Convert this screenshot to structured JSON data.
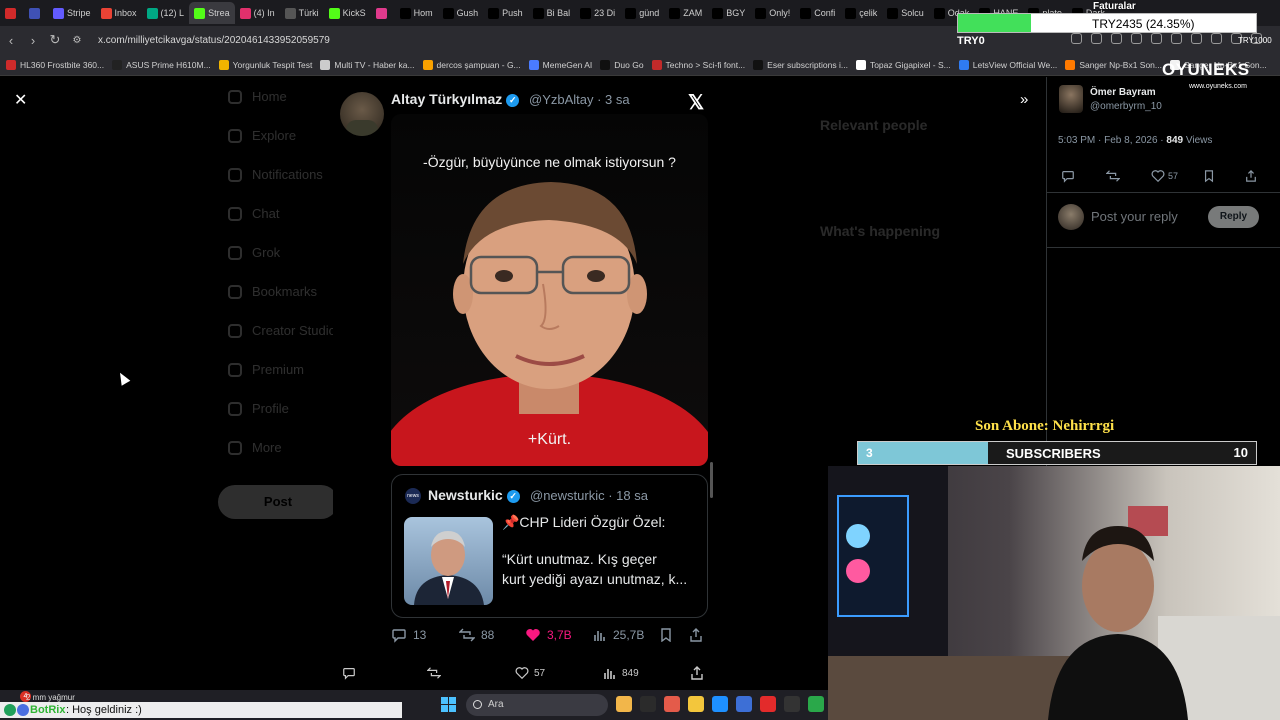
{
  "browser": {
    "tabs": [
      {
        "label": "",
        "color": "#d12a2a"
      },
      {
        "label": "",
        "color": "#3f51b5"
      },
      {
        "label": "Stripe",
        "color": "#635bff"
      },
      {
        "label": "Inbox",
        "color": "#ea4335"
      },
      {
        "label": "(12) L",
        "color": "#00a884"
      },
      {
        "label": "Strea",
        "color": "#53fc18",
        "active": true
      },
      {
        "label": "(4) In",
        "color": "#e1306c"
      },
      {
        "label": "Türki",
        "color": "#555555"
      },
      {
        "label": "KickS",
        "color": "#53fc18"
      },
      {
        "label": "",
        "color": "#e03a8c"
      },
      {
        "label": "Hom",
        "color": "#000000"
      },
      {
        "label": "Gush",
        "color": "#000000"
      },
      {
        "label": "Push",
        "color": "#000000"
      },
      {
        "label": "Bi Bal",
        "color": "#000000"
      },
      {
        "label": "23 Di",
        "color": "#000000"
      },
      {
        "label": "günd",
        "color": "#000000"
      },
      {
        "label": "ZAM",
        "color": "#000000"
      },
      {
        "label": "BGY",
        "color": "#000000"
      },
      {
        "label": "Only!",
        "color": "#000000"
      },
      {
        "label": "Confi",
        "color": "#000000"
      },
      {
        "label": "çelik",
        "color": "#000000"
      },
      {
        "label": "Solcu",
        "color": "#000000"
      },
      {
        "label": "Odak",
        "color": "#000000"
      },
      {
        "label": "HANE",
        "color": "#000000"
      },
      {
        "label": "plato",
        "color": "#000000"
      },
      {
        "label": "Dark",
        "color": "#000000"
      }
    ],
    "url": "x.com/milliyetcikavga/status/2020461433952059579",
    "bookmarks": [
      {
        "label": "HL360 Frostbite 360...",
        "color": "#cf2b2b"
      },
      {
        "label": "ASUS Prime H610M...",
        "color": "#222222"
      },
      {
        "label": "Yorgunluk Tespit Test",
        "color": "#f0b400"
      },
      {
        "label": "Multi TV - Haber ka...",
        "color": "#cccccc"
      },
      {
        "label": "dercos şampuan - G...",
        "color": "#f8a100"
      },
      {
        "label": "MemeGen AI",
        "color": "#4a7bff"
      },
      {
        "label": "Duo Go",
        "color": "#101010"
      },
      {
        "label": "Techno > Sci-fi font...",
        "color": "#c22a2a"
      },
      {
        "label": "Eser subscriptions i...",
        "color": "#111111"
      },
      {
        "label": "Topaz Gigapixel - S...",
        "color": "#ffffff"
      },
      {
        "label": "LetsView Official We...",
        "color": "#2f7bf2"
      },
      {
        "label": "Sanger Np-Bx1 Son...",
        "color": "#ff7a00"
      },
      {
        "label": "Sanger Np-Bx1 Son...",
        "color": "#f2f2f2"
      }
    ]
  },
  "dim": {
    "nav": [
      "Home",
      "Explore",
      "Notifications",
      "Chat",
      "Grok",
      "Bookmarks",
      "Creator Studio",
      "Premium",
      "Profile",
      "More"
    ],
    "post_label": "Post",
    "relevant": "Relevant people",
    "happening": "What's happening"
  },
  "tweet": {
    "name": "Altay Türkyılmaz",
    "handle": "@YzbAltay · 3 sa",
    "image_top_text": "-Özgür, büyüyünce ne olmak istiyorsun ?",
    "image_bottom_text": "+Kürt.",
    "quote": {
      "logo": "news",
      "name": "Newsturkic",
      "handle": "@newsturkic · 18 sa",
      "line1": "📌CHP Lideri Özgür Özel:",
      "line2": "“Kürt unutmaz. Kış geçer",
      "line3": "kurt yediği ayazı unutmaz, k..."
    },
    "replies": "13",
    "reposts": "88",
    "likes": "3,7B",
    "views": "25,7B"
  },
  "bottom_bar": {
    "likes": "57",
    "views": "849"
  },
  "reply_panel": {
    "name": "Ömer Bayram",
    "handle": "@omerbyrm_10",
    "meta": "5:03 PM · Feb 8, 2026 · ",
    "views_count": "849",
    "views_label": " Views",
    "likes": "57",
    "placeholder": "Post your reply",
    "reply_button": "Reply"
  },
  "overlay": {
    "try_text": "TRY2435 (24.35%)",
    "try_progress": 0.2435,
    "faturalar": "Faturalar",
    "try0": "TRY0",
    "try1": "TRY1000",
    "oyuneks": "OYUNEKS",
    "oyuneks_url": "www.oyuneks.com",
    "son_abone": "Son Abone: Nehirrrgi",
    "subs_current": "3",
    "subs_label": "SUBSCRIBERS",
    "subs_goal": "10",
    "subs_progress": 0.3
  },
  "taskbar": {
    "weather": "2 mm yağmur",
    "weather_badge": "4",
    "search_label": "Ara",
    "chat_user": "BotRix",
    "chat_msg": ": Hoş geldiniz :)",
    "icons": [
      "#f2b64a",
      "#2b2b2b",
      "#e45b4a",
      "#f3c63c",
      "#1e90ff",
      "#3d6fd6",
      "#e32b2b",
      "#333333",
      "#2aa84a"
    ]
  }
}
